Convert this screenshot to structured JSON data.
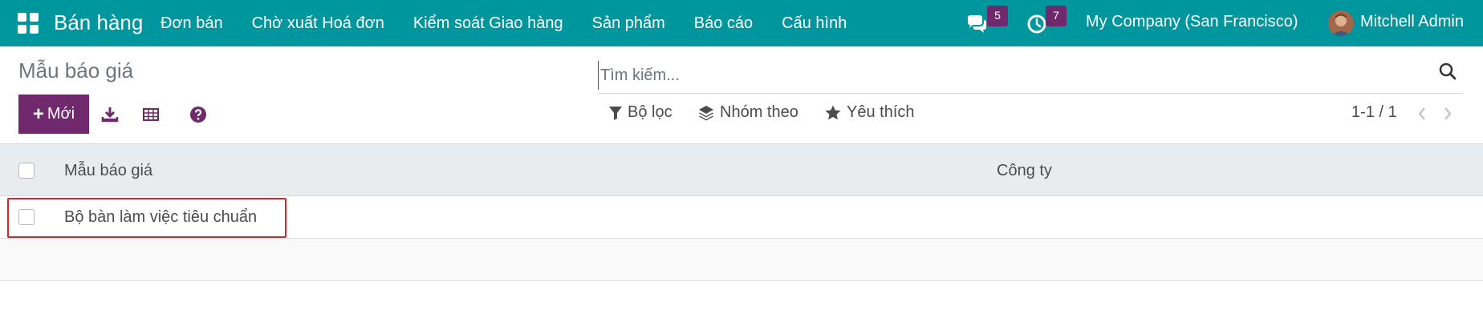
{
  "navbar": {
    "app_name": "Bán hàng",
    "menu": [
      {
        "label": "Đơn bán"
      },
      {
        "label": "Chờ xuất Hoá đơn"
      },
      {
        "label": "Kiểm soát Giao hàng"
      },
      {
        "label": "Sản phẩm"
      },
      {
        "label": "Báo cáo"
      },
      {
        "label": "Cấu hình"
      }
    ],
    "messages_count": "5",
    "activities_count": "7",
    "company": "My Company (San Francisco)",
    "user": "Mitchell Admin"
  },
  "control_panel": {
    "title": "Mẫu báo giá",
    "new_button": "Mới",
    "search_placeholder": "Tìm kiếm...",
    "filters_label": "Bộ lọc",
    "group_by_label": "Nhóm theo",
    "favorites_label": "Yêu thích",
    "pager": "1-1 / 1"
  },
  "list": {
    "columns": [
      "Mẫu báo giá",
      "Công ty"
    ],
    "rows": [
      {
        "name": "Bộ bàn làm việc tiêu chuẩn",
        "company": ""
      }
    ]
  },
  "colors": {
    "navbar": "#00969d",
    "primary": "#71296d",
    "badge": "#71296d",
    "highlight": "#d3262f"
  },
  "icons": [
    "apps-grid-icon",
    "chat-icon",
    "clock-icon",
    "download-icon",
    "table-icon",
    "help-icon",
    "search-icon",
    "filter-icon",
    "layers-icon",
    "star-icon",
    "chevron-left-icon",
    "chevron-right-icon"
  ]
}
